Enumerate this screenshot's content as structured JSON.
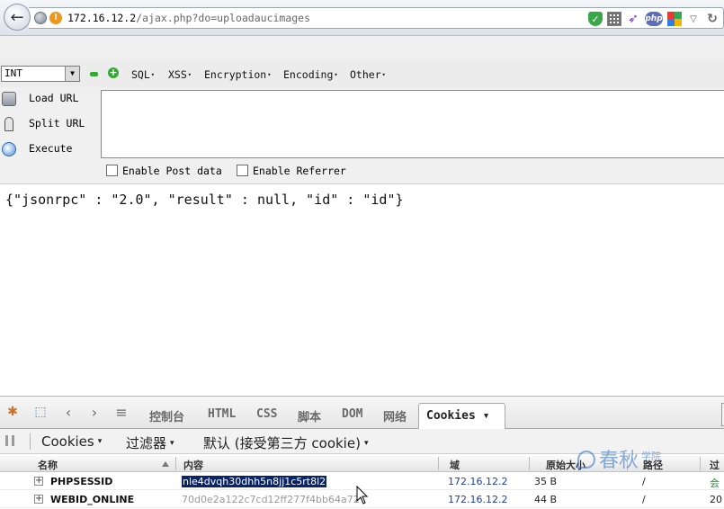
{
  "browser": {
    "url_host": "172.16.12.2",
    "url_path": "/ajax.php?do=uploadaucimages",
    "php_badge": "php"
  },
  "hackbar": {
    "select_value": "INT",
    "menus": [
      "SQL",
      "XSS",
      "Encryption",
      "Encoding",
      "Other"
    ],
    "load_url": "Load URL",
    "split_url": "Split URL",
    "execute": "Execute",
    "textarea_value": "",
    "enable_post": "Enable Post data",
    "enable_referrer": "Enable Referrer"
  },
  "page": {
    "response": "{\"jsonrpc\" : \"2.0\", \"result\" : null, \"id\" : \"id\"}"
  },
  "firebug": {
    "tabs": [
      "控制台",
      "HTML",
      "CSS",
      "脚本",
      "DOM",
      "网络"
    ],
    "active_tab": "Cookies ▾",
    "subbar": {
      "cookies": "Cookies",
      "filter": "过滤器",
      "default": "默认 (接受第三方 cookie)"
    },
    "columns": {
      "name": "名称",
      "content": "内容",
      "domain": "域",
      "raw_size": "原始大小",
      "path": "路径",
      "http": "过"
    },
    "rows": [
      {
        "name": "PHPSESSID",
        "value": "nle4dvqh30dhh5n8jj1c5rt8l2",
        "domain": "172.16.12.2",
        "size": "35 B",
        "path": "/",
        "extra": "会"
      },
      {
        "name": "WEBID_ONLINE",
        "value": "70d0e2a122c7cd12ff277f4bb64a72",
        "domain": "172.16.12.2",
        "size": "44 B",
        "path": "/",
        "extra": "20"
      }
    ]
  },
  "watermark": {
    "text": "春秋",
    "small": "学院"
  }
}
